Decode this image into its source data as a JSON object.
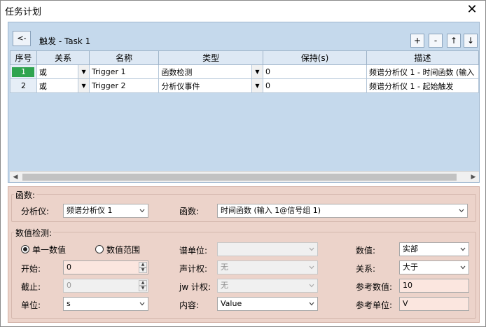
{
  "window": {
    "title": "任务计划",
    "close_glyph": "✕"
  },
  "trigger_panel": {
    "back_label": "<-",
    "title": "触发 - Task 1",
    "tools": [
      "+",
      "-",
      "↑",
      "↓"
    ]
  },
  "grid": {
    "headers": [
      "序号",
      "关系",
      "名称",
      "类型",
      "保持(s)",
      "描述"
    ],
    "rows": [
      {
        "index": "1",
        "relation": "或",
        "name": "Trigger 1",
        "type": "函数检测",
        "hold": "0",
        "description": "频谱分析仪 1 - 时间函数 (输入"
      },
      {
        "index": "2",
        "relation": "或",
        "name": "Trigger 2",
        "type": "分析仪事件",
        "hold": "0",
        "description": "频谱分析仪 1 - 起始触发"
      }
    ],
    "scroll_left": "◀",
    "scroll_right": "▶"
  },
  "function_group": {
    "title": "函数:",
    "analyzer_label": "分析仪:",
    "analyzer_value": "频谱分析仪 1",
    "function_label": "函数:",
    "function_value": "时间函数 (输入 1@信号组 1)"
  },
  "detect_group": {
    "title": "数值检测:",
    "radio_single": "单一数值",
    "radio_range": "数值范围",
    "start_label": "开始:",
    "start_value": "0",
    "stop_label": "截止:",
    "stop_value": "0",
    "unit_label": "单位:",
    "unit_value": "s",
    "spectrum_unit_label": "谱单位:",
    "spectrum_unit_value": "",
    "acoustic_label": "声计权:",
    "acoustic_value": "无",
    "jw_label": "jw 计权:",
    "jw_value": "无",
    "content_label": "内容:",
    "content_value": "Value",
    "value_label": "数值:",
    "value_value": "实部",
    "relation_label": "关系:",
    "relation_value": "大于",
    "ref_value_label": "参考数值:",
    "ref_value_value": "10",
    "ref_unit_label": "参考单位:",
    "ref_unit_value": "V"
  }
}
